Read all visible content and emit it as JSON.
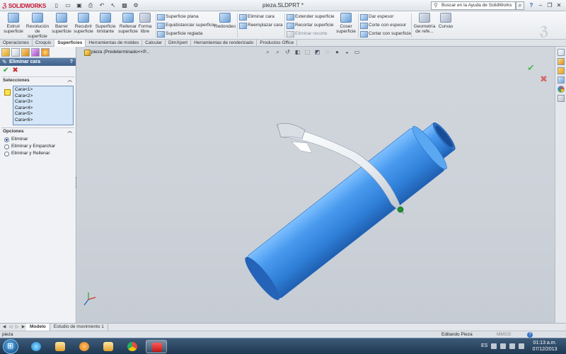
{
  "app": {
    "brand": "SOLIDWORKS",
    "document_title": "pieza.SLDPRT *",
    "search_placeholder": "Buscar en la Ayuda de SolidWorks",
    "help_label": "?"
  },
  "ribbon": {
    "big_buttons": [
      {
        "label": "Extruir superficie"
      },
      {
        "label": "Revolución de superficie"
      },
      {
        "label": "Barrer superficie"
      },
      {
        "label": "Recubrir superficie"
      },
      {
        "label": "Superficie limitante"
      },
      {
        "label": "Rellenar superficie"
      },
      {
        "label": "Forma libre"
      }
    ],
    "small_buttons": [
      {
        "label": "Superficie plana",
        "enabled": true
      },
      {
        "label": "Equidistanciar superficie",
        "enabled": true
      },
      {
        "label": "Superficie reglada",
        "enabled": true
      },
      {
        "label": "Redondeo",
        "enabled": true
      },
      {
        "label": "Eliminar cara",
        "enabled": true
      },
      {
        "label": "Reemplazar cara",
        "enabled": true
      },
      {
        "label": "Extender superficie",
        "enabled": true
      },
      {
        "label": "Recortar superficie",
        "enabled": true
      },
      {
        "label": "Eliminar recorte",
        "enabled": false
      },
      {
        "label": "Coser superficie",
        "enabled": true
      },
      {
        "label": "Dar espesor",
        "enabled": true
      },
      {
        "label": "Corte con espesor",
        "enabled": true
      },
      {
        "label": "Cortar con superficie",
        "enabled": true
      },
      {
        "label": "Geometría de refe...",
        "enabled": true
      },
      {
        "label": "Curvas",
        "enabled": true
      }
    ]
  },
  "command_tabs": [
    {
      "label": "Operaciones"
    },
    {
      "label": "Croquis"
    },
    {
      "label": "Superficies",
      "active": true
    },
    {
      "label": "Herramientas de moldes"
    },
    {
      "label": "Calcular"
    },
    {
      "label": "DimXpert"
    },
    {
      "label": "Herramientas de renderizado"
    },
    {
      "label": "Productos Office"
    }
  ],
  "property_manager": {
    "title": "Eliminar cara",
    "help": "?",
    "selections_title": "Selecciones",
    "faces": [
      "Cara<1>",
      "Cara<2>",
      "Cara<3>",
      "Cara<4>",
      "Cara<5>",
      "Cara<6>"
    ],
    "options_title": "Opciones",
    "options": [
      {
        "label": "Eliminar",
        "selected": true
      },
      {
        "label": "Eliminar y Emparchar",
        "selected": false
      },
      {
        "label": "Eliminar y Rellenar",
        "selected": false
      }
    ]
  },
  "viewport": {
    "tree_node": "pieza  (Predeterminado<<P..."
  },
  "bottom_tabs": [
    {
      "label": "Modelo",
      "active": true
    },
    {
      "label": "Estudio de movimiento 1"
    }
  ],
  "status": {
    "left": "pieza",
    "mode": "Editando Pieza",
    "units": "MMGS",
    "help": "?"
  },
  "taskbar": {
    "language": "ES",
    "time": "01:13 a.m.",
    "date": "07/12/2013"
  },
  "colors": {
    "model_blue": "#3d8fe6",
    "accent_red": "#c8102e",
    "header_blue": "#4f7099"
  }
}
